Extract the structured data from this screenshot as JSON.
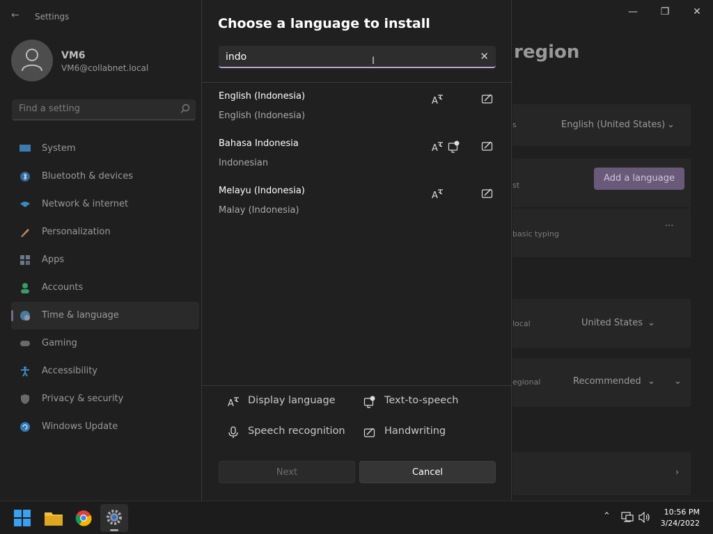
{
  "settings": {
    "window_title": "Settings",
    "user": {
      "name": "VM6",
      "email": "VM6@collabnet.local"
    },
    "search_placeholder": "Find a setting",
    "nav": [
      {
        "label": "System",
        "icon": "monitor-icon"
      },
      {
        "label": "Bluetooth & devices",
        "icon": "bluetooth-icon"
      },
      {
        "label": "Network & internet",
        "icon": "wifi-icon"
      },
      {
        "label": "Personalization",
        "icon": "brush-icon"
      },
      {
        "label": "Apps",
        "icon": "apps-icon"
      },
      {
        "label": "Accounts",
        "icon": "person-icon"
      },
      {
        "label": "Time & language",
        "icon": "globe-clock-icon",
        "active": true
      },
      {
        "label": "Gaming",
        "icon": "gamepad-icon"
      },
      {
        "label": "Accessibility",
        "icon": "accessibility-icon"
      },
      {
        "label": "Privacy & security",
        "icon": "shield-icon"
      },
      {
        "label": "Windows Update",
        "icon": "update-icon"
      }
    ],
    "page_heading_fragment": "region",
    "bg": {
      "row1_small": "s",
      "row1_value": "English (United States)",
      "row2_small": "st",
      "add_language_label": "Add a language",
      "row3_small": "basic typing",
      "more_label": "···",
      "row4_small": "local",
      "row4_value": "United States",
      "row5_small": "egional",
      "row5_value": "Recommended"
    }
  },
  "dialog": {
    "title": "Choose a language to install",
    "search_value": "indo",
    "results": [
      {
        "name": "English (Indonesia)",
        "sub": "English (Indonesia)",
        "features": [
          "display-language",
          "handwriting"
        ]
      },
      {
        "name": "Bahasa Indonesia",
        "sub": "Indonesian",
        "features": [
          "display-language",
          "text-to-speech",
          "handwriting"
        ]
      },
      {
        "name": "Melayu (Indonesia)",
        "sub": "Malay (Indonesia)",
        "features": [
          "display-language",
          "handwriting"
        ]
      }
    ],
    "legend": {
      "display_language": "Display language",
      "text_to_speech": "Text-to-speech",
      "speech_recognition": "Speech recognition",
      "handwriting": "Handwriting"
    },
    "next_label": "Next",
    "cancel_label": "Cancel"
  },
  "taskbar": {
    "apps": [
      "start-icon",
      "file-explorer-icon",
      "chrome-icon",
      "settings-gear-icon"
    ],
    "time": "10:56 PM",
    "date": "3/24/2022"
  }
}
